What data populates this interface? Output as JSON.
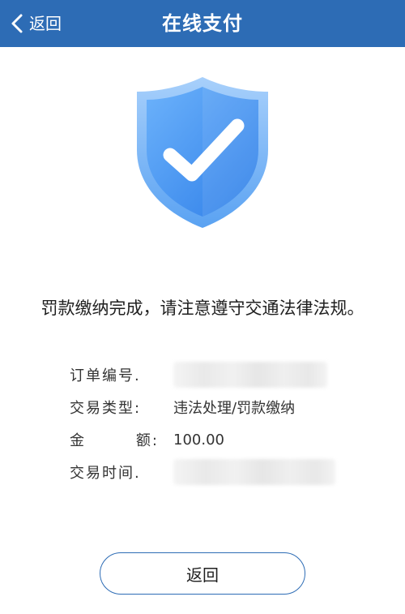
{
  "header": {
    "back_label": "返回",
    "title": "在线支付",
    "background_color": "#2d6cb5"
  },
  "status": {
    "icon": "shield-check-icon",
    "message": "罚款缴纳完成，请注意遵守交通法律法规。"
  },
  "details": {
    "order_number": {
      "label": "订单编号.",
      "value": ""
    },
    "transaction_type": {
      "label": "交易类型:",
      "value": "违法处理/罚款缴纳"
    },
    "amount": {
      "label_left": "金",
      "label_right": "额:",
      "value": "100.00"
    },
    "transaction_time": {
      "label": "交易时间.",
      "value": ""
    }
  },
  "footer": {
    "return_button_label": "返回",
    "accent_color": "#2d6cb5"
  }
}
